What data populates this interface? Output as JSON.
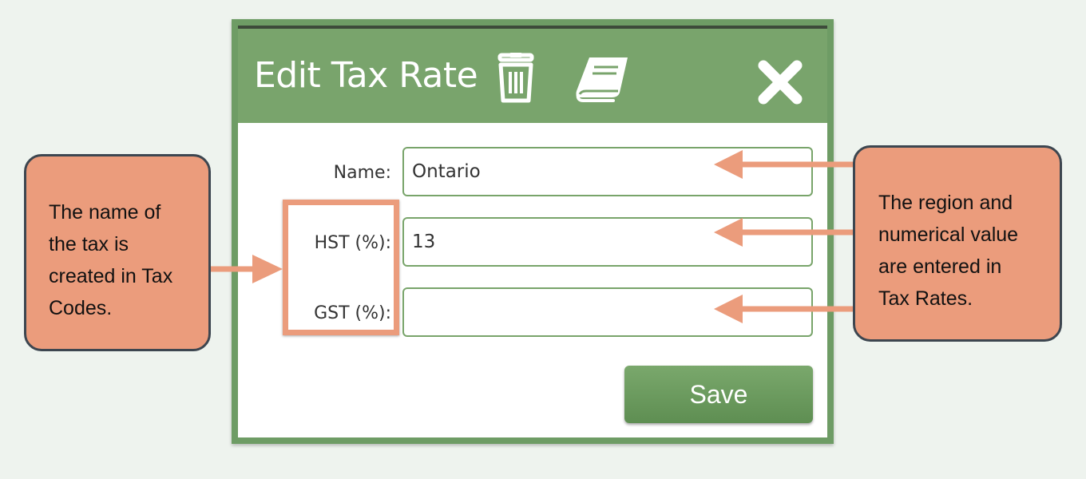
{
  "dialog": {
    "title": "Edit Tax Rate",
    "icons": [
      "trash-icon",
      "book-icon",
      "close-icon"
    ],
    "fields": [
      {
        "label": "Name:",
        "value": "Ontario"
      },
      {
        "label": "HST (%):",
        "value": "13"
      },
      {
        "label": "GST (%):",
        "value": ""
      }
    ],
    "save_label": "Save"
  },
  "annotations": {
    "left_lines": [
      "The name of",
      "the tax is",
      "created in Tax",
      "Codes."
    ],
    "right_lines": [
      "The region and",
      "numerical value",
      "are entered in",
      "Tax Rates."
    ]
  },
  "colors": {
    "header": "#79a46c",
    "border": "#6e9c65",
    "callout": "#eb9c7c",
    "background": "#eef3ee"
  }
}
